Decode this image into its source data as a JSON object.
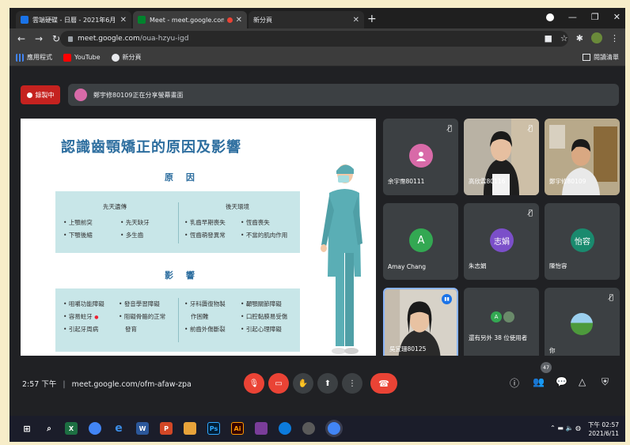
{
  "browser": {
    "tabs": [
      {
        "title": "雲端硬碟 - 日曆 - 2021年6月",
        "favicon_color": "#1a73e8",
        "active": false
      },
      {
        "title": "Meet - meet.google.com/oua-h",
        "favicon_color": "#00832d",
        "active": true
      },
      {
        "title": "新分頁",
        "favicon_color": "",
        "active": false
      }
    ],
    "new_tab_label": "+",
    "url_host": "meet.google.com",
    "url_path": "/oua-hzyu-igd",
    "bookmarks": [
      {
        "label": "應用程式",
        "icon": "apps-grid-icon",
        "color": "#4285f4"
      },
      {
        "label": "YouTube",
        "icon": "youtube-icon",
        "color": "#ff0000"
      },
      {
        "label": "新分頁",
        "icon": "globe-icon",
        "color": "#e8eaed"
      }
    ],
    "reading_list_label": "閱讀清單"
  },
  "meet": {
    "recording_label": "錄製中",
    "share_notice": "鄭宇修80109正在分享螢幕畫面",
    "meeting_time": "2:57 下午",
    "meeting_url": "meet.google.com/ofm-afaw-zpa",
    "participant_count": "47",
    "accent_red": "#ea4335"
  },
  "slide": {
    "title": "認識齒顎矯正的原因及影響",
    "cause_heading": "原 因",
    "effect_heading": "影 響",
    "cause_columns": [
      {
        "head": "先天遺傳",
        "items": [
          "上顎前突",
          "先天缺牙",
          "下顎後縮",
          "多生齒"
        ]
      },
      {
        "head": "後天環境",
        "items": [
          "乳齒早期喪失",
          "恆齒喪失",
          "恆齒萌發異常",
          "不當的肌肉作用"
        ]
      }
    ],
    "effect_items": [
      [
        "咀嚼功能障礙",
        "容易蛀牙",
        "引起牙周病"
      ],
      [
        "發音學習障礙",
        "阻礙骨骼的正常",
        "發育"
      ],
      [
        "牙科贗復物製",
        "作困難",
        "前齒外傷斷裂"
      ],
      [
        "顳顎關節障礙",
        "口腔黏膜易受傷",
        "引起心理障礙"
      ]
    ]
  },
  "participants": [
    {
      "name": "余宇霈80111",
      "initial": "",
      "avatar_color": "#d86aa8",
      "muted": true,
      "photo": false
    },
    {
      "name": "高欣霖80116",
      "initial": "",
      "avatar_color": "",
      "muted": true,
      "photo": true
    },
    {
      "name": "鄭宇修80109",
      "initial": "",
      "avatar_color": "",
      "muted": false,
      "photo": true
    },
    {
      "name": "Amay Chang",
      "initial": "A",
      "avatar_color": "#33a852",
      "muted": false,
      "photo": false
    },
    {
      "name": "朱志娟",
      "initial": "志娟",
      "avatar_color": "#7b4fc9",
      "muted": true,
      "photo": false
    },
    {
      "name": "陳怡容",
      "initial": "怡容",
      "avatar_color": "#1a8a6e",
      "muted": false,
      "photo": false
    },
    {
      "name": "吳宜珊80125",
      "initial": "",
      "avatar_color": "",
      "muted": false,
      "photo": true
    },
    {
      "name": "還有另外 38 位使用者",
      "initial": "",
      "avatar_color": "",
      "muted": false,
      "photo": false
    },
    {
      "name": "你",
      "initial": "",
      "avatar_color": "",
      "muted": true,
      "photo": false
    }
  ],
  "taskbar": {
    "clock_time": "下午 02:57",
    "clock_date": "2021/6/11"
  }
}
